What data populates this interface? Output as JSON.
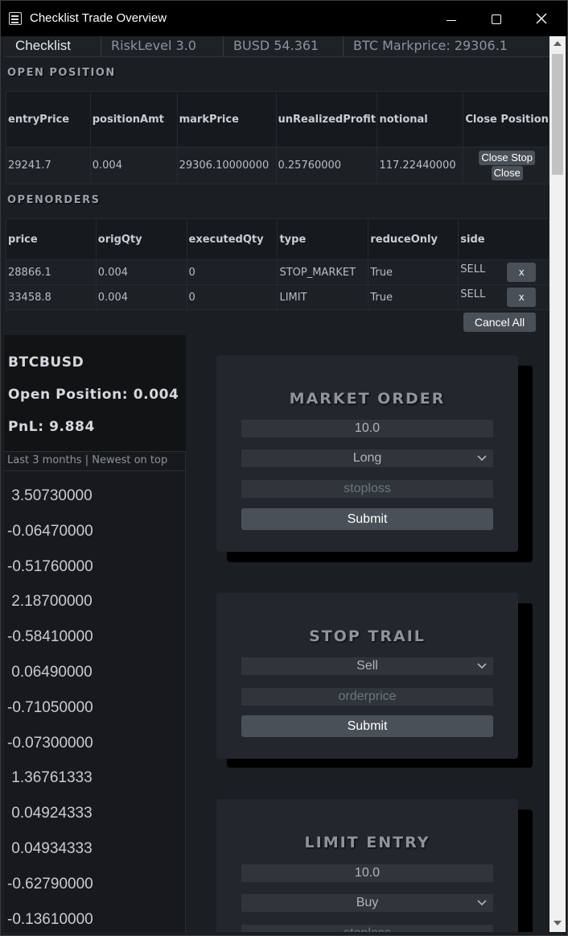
{
  "window": {
    "title": "Checklist Trade Overview"
  },
  "nav": {
    "brand": "Checklist",
    "risk": "RiskLevel 3.0",
    "busd": "BUSD 54.361",
    "markprice": "BTC Markprice: 29306.1"
  },
  "open_position": {
    "heading": "OPEN POSITION",
    "columns": [
      "entryPrice",
      "positionAmt",
      "markPrice",
      "unRealizedProfit",
      "notional",
      "Close Position"
    ],
    "row": [
      "29241.7",
      "0.004",
      "29306.10000000",
      "0.25760000",
      "117.22440000"
    ],
    "close_stop_label": "Close Stop",
    "close_label": "Close"
  },
  "open_orders": {
    "heading": "OPENORDERS",
    "columns": [
      "price",
      "origQty",
      "executedQty",
      "type",
      "reduceOnly",
      "side"
    ],
    "rows": [
      [
        "28866.1",
        "0.004",
        "0",
        "STOP_MARKET",
        "True",
        "SELL"
      ],
      [
        "33458.8",
        "0.004",
        "0",
        "LIMIT",
        "True",
        "SELL"
      ]
    ],
    "cancel_label": "x",
    "cancel_all_label": "Cancel All"
  },
  "stats": {
    "symbol": "BTCBUSD",
    "open_position": "Open Position: 0.004",
    "pnl": "PnL: 9.884"
  },
  "history": {
    "header": "Last 3 months | Newest on top",
    "values": [
      " 3.50730000",
      "-0.06470000",
      "-0.51760000",
      " 2.18700000",
      "-0.58410000",
      " 0.06490000",
      "-0.71050000",
      "-0.07300000",
      " 1.36761333",
      " 0.04924333",
      " 0.04934333",
      "-0.62790000",
      "-0.13610000"
    ]
  },
  "market_order": {
    "title": "MARKET ORDER",
    "amount": "10.0",
    "side": "Long",
    "stoploss_placeholder": "stoploss",
    "submit": "Submit"
  },
  "stop_trail": {
    "title": "STOP TRAIL",
    "side": "Sell",
    "orderprice_placeholder": "orderprice",
    "submit": "Submit"
  },
  "limit_entry": {
    "title": "LIMIT ENTRY",
    "amount": "10.0",
    "side": "Buy",
    "stoploss_placeholder": "stoploss"
  }
}
